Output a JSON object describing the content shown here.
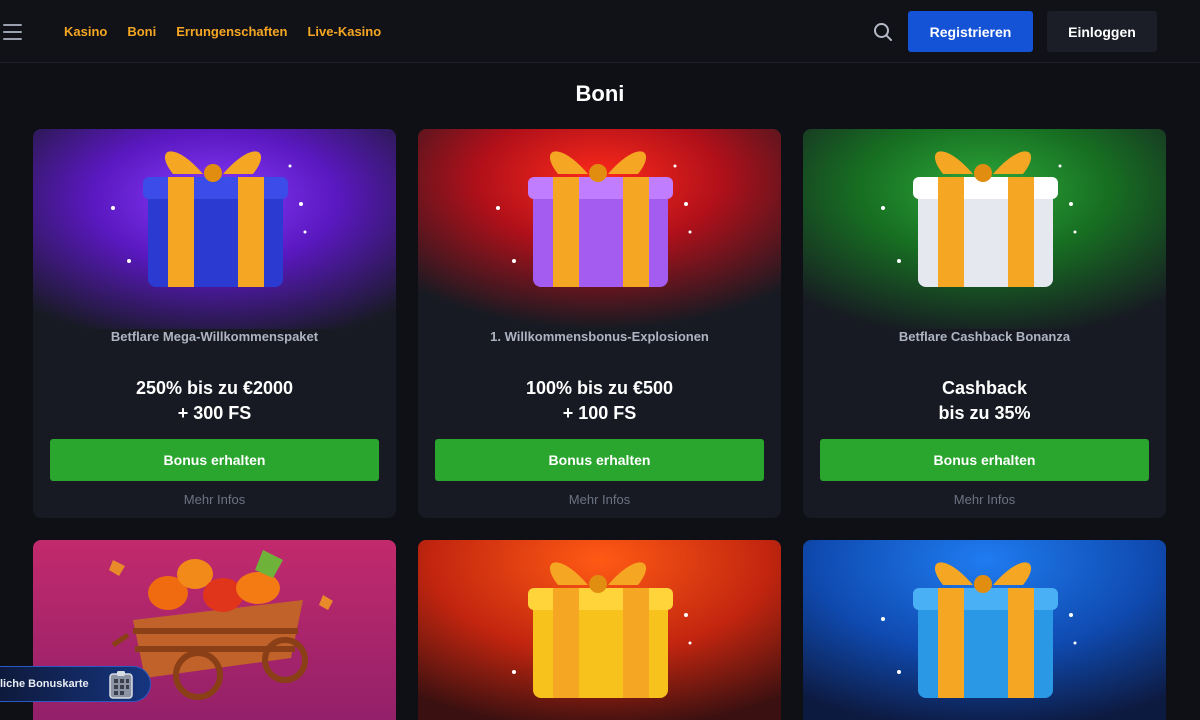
{
  "header": {
    "nav": [
      "Kasino",
      "Boni",
      "Errungenschaften",
      "Live-Kasino"
    ],
    "register_label": "Registrieren",
    "login_label": "Einloggen",
    "icons": {
      "menu": "hamburger-menu-icon",
      "search": "search-icon"
    }
  },
  "page": {
    "title": "Boni"
  },
  "cards": [
    {
      "subtitle": "Betflare Mega-Willkommenspaket",
      "offer_line1": "250% bis zu €2000",
      "offer_line2": "+ 300 FS",
      "cta": "Bonus erhalten",
      "more": "Mehr Infos",
      "image": "gift-icon",
      "bg_color": "#6a1fd9",
      "box_color": "#2b3ad0"
    },
    {
      "subtitle": "1. Willkommensbonus-Explosionen",
      "offer_line1": "100% bis zu €500",
      "offer_line2": "+ 100 FS",
      "cta": "Bonus erhalten",
      "more": "Mehr Infos",
      "image": "gift-icon",
      "bg_color": "#e0141a",
      "box_color": "#a45cf0"
    },
    {
      "subtitle": "Betflare Cashback Bonanza",
      "offer_line1": "Cashback",
      "offer_line2": "bis zu 35%",
      "cta": "Bonus erhalten",
      "more": "Mehr Infos",
      "image": "gift-icon",
      "bg_color": "#1f8a2a",
      "box_color": "#eef0f6"
    },
    {
      "image": "pumpkin-cart-icon",
      "bg_color": "#c22a6c"
    },
    {
      "image": "gift-icon",
      "bg_color": "#f2420f",
      "box_color": "#f7c21c"
    },
    {
      "image": "gift-icon",
      "bg_color": "#1565e0",
      "box_color": "#2b98e6"
    }
  ],
  "floating": {
    "bonus_card_label": "liche Bonuskarte",
    "icon": "bonus-card-icon"
  }
}
